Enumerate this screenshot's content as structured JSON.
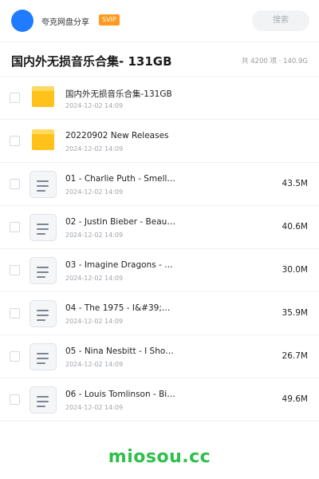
{
  "header": {
    "share_name": "夸克网盘分享",
    "badge": "SVIP",
    "search_label": "搜索"
  },
  "title_bar": {
    "title": "国内外无损音乐合集- 131GB",
    "summary": "共 4200 项 · 140.9G"
  },
  "items": [
    {
      "type": "folder",
      "name": "国内外无损音乐合集-131GB",
      "date": "2024-12-02 14:09",
      "size": ""
    },
    {
      "type": "folder",
      "name": "20220902 New Releases",
      "date": "2024-12-02 14:09",
      "size": ""
    },
    {
      "type": "file",
      "name": "01 - Charlie Puth - Smell…",
      "date": "2024-12-02 14:09",
      "size": "43.5M"
    },
    {
      "type": "file",
      "name": "02 - Justin Bieber - Beau…",
      "date": "2024-12-02 14:09",
      "size": "40.6M"
    },
    {
      "type": "file",
      "name": "03 - Imagine Dragons - Lo…",
      "date": "2024-12-02 14:09",
      "size": "30.0M"
    },
    {
      "type": "file",
      "name": "04 - The 1975 - I&#39;m I…",
      "date": "2024-12-02 14:09",
      "size": "35.9M"
    },
    {
      "type": "file",
      "name": "05 - Nina Nesbitt - I Sho…",
      "date": "2024-12-02 14:09",
      "size": "26.7M"
    },
    {
      "type": "file",
      "name": "06 - Louis Tomlinson - Bi…",
      "date": "2024-12-02 14:09",
      "size": "49.6M"
    }
  ],
  "watermark": "miosou.cc",
  "colors": {
    "avatar": "#1f7bff",
    "badge": "#ff9a1e",
    "folder": "#ffc21a",
    "watermark": "#2fbf4a"
  }
}
